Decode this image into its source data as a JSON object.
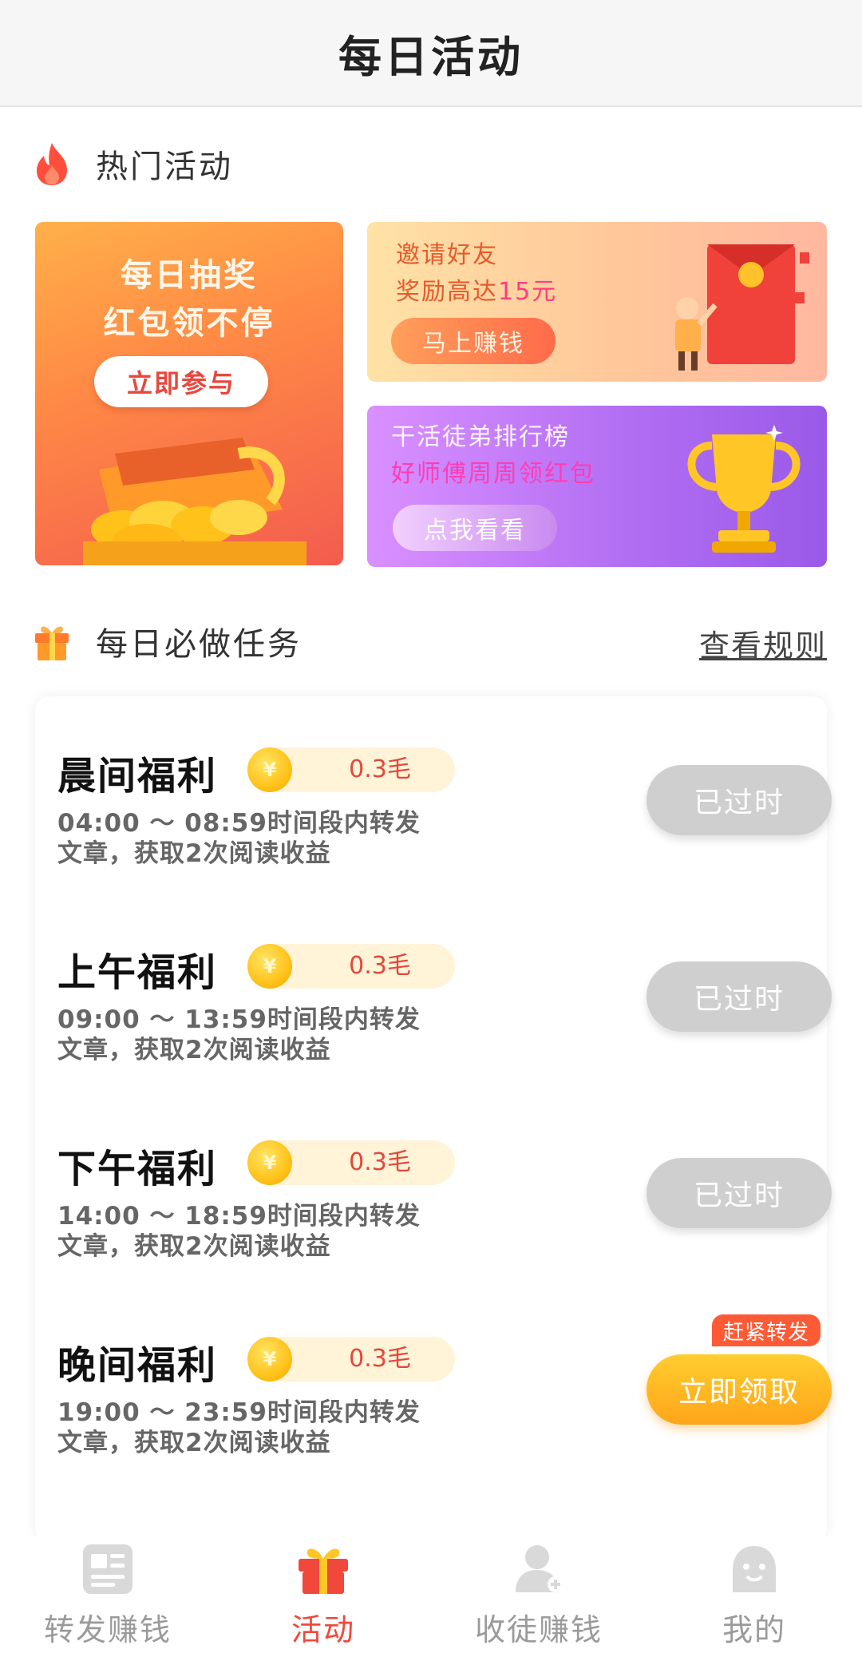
{
  "header": {
    "title": "每日活动"
  },
  "hot_section": {
    "title": "热门活动",
    "icon": "flame-icon"
  },
  "banners": {
    "lottery": {
      "line1": "每日抽奖",
      "line2": "红包领不停",
      "button": "立即参与"
    },
    "invite": {
      "line1": "邀请好友",
      "line2_prefix": "奖励高达",
      "line2_highlight": "15元",
      "button": "马上赚钱"
    },
    "rank": {
      "line1": "干活徒弟排行榜",
      "line2": "好师傅周周领红包",
      "button": "点我看看"
    }
  },
  "tasks_section": {
    "title": "每日必做任务",
    "icon": "gift-icon",
    "rules_link": "查看规则"
  },
  "tasks": [
    {
      "name": "晨间福利",
      "coin": "¥",
      "reward": "0.3毛",
      "desc_line1": "04:00 ～ 08:59时间段内转发",
      "desc_line2": "文章，获取2次阅读收益",
      "button": "已过时",
      "badge": ""
    },
    {
      "name": "上午福利",
      "coin": "¥",
      "reward": "0.3毛",
      "desc_line1": "09:00 ～ 13:59时间段内转发",
      "desc_line2": "文章，获取2次阅读收益",
      "button": "已过时",
      "badge": ""
    },
    {
      "name": "下午福利",
      "coin": "¥",
      "reward": "0.3毛",
      "desc_line1": "14:00 ～ 18:59时间段内转发",
      "desc_line2": "文章，获取2次阅读收益",
      "button": "已过时",
      "badge": ""
    },
    {
      "name": "晚间福利",
      "coin": "¥",
      "reward": "0.3毛",
      "desc_line1": "19:00 ～ 23:59时间段内转发",
      "desc_line2": "文章，获取2次阅读收益",
      "button": "立即领取",
      "badge": "赶紧转发"
    }
  ],
  "nav": [
    {
      "label": "转发赚钱",
      "icon": "article-icon",
      "active": false
    },
    {
      "label": "活动",
      "icon": "gift-icon",
      "active": true
    },
    {
      "label": "收徒赚钱",
      "icon": "add-user-icon",
      "active": false
    },
    {
      "label": "我的",
      "icon": "smiley-icon",
      "active": false
    }
  ],
  "colors": {
    "accent": "#f0493c",
    "active_button": "#ffb01f",
    "disabled_button": "#cfcfcf",
    "reward_text": "#e2483b"
  }
}
